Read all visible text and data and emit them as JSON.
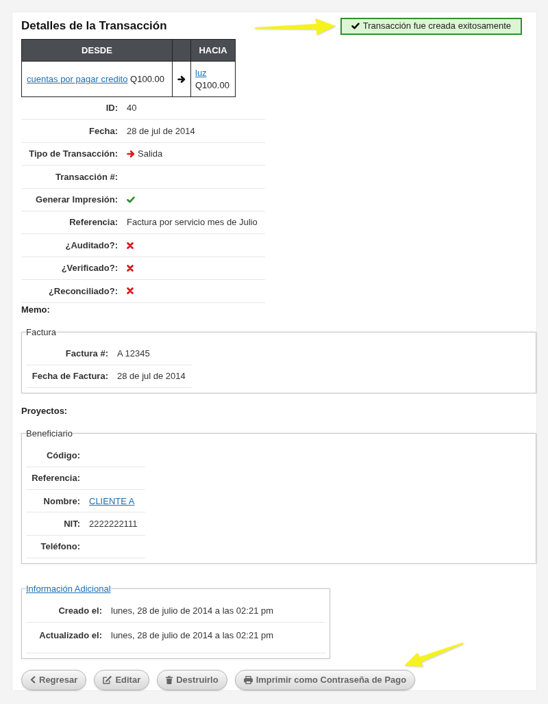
{
  "page": {
    "title": "Detalles de la Transacción"
  },
  "alert": {
    "kind": "success",
    "text": "Transacción fue creada exitosamente"
  },
  "transfer": {
    "columns": [
      "DESDE",
      "HACIA"
    ],
    "from": {
      "account": "cuentas por pagar credito",
      "amount": "Q100.00"
    },
    "to": {
      "account": "luz",
      "amount": "Q100.00"
    }
  },
  "details": [
    {
      "label": "ID:",
      "kind": "text",
      "value": "40"
    },
    {
      "label": "Fecha:",
      "kind": "text",
      "value": "28 de jul de 2014"
    },
    {
      "label": "Tipo de Transacción:",
      "kind": "direction",
      "value": "Salida"
    },
    {
      "label": "Transacción #:",
      "kind": "text"
    },
    {
      "label": "Generar Impresión:",
      "kind": "flag",
      "checked": true
    },
    {
      "label": "Referencia:",
      "kind": "text",
      "value": "Factura por servicio mes de Julio"
    },
    {
      "label": "¿Auditado?:",
      "kind": "flag",
      "checked": false
    },
    {
      "label": "¿Verificado?:",
      "kind": "flag",
      "checked": false
    },
    {
      "label": "¿Reconciliado?:",
      "kind": "flag",
      "checked": false
    }
  ],
  "memo": {
    "label": "Memo:"
  },
  "invoice": {
    "legend": "Factura",
    "legend_link": false,
    "rows": [
      {
        "label": "Factura #:",
        "kind": "text",
        "value": "A 12345"
      },
      {
        "label": "Fecha de Factura:",
        "kind": "text",
        "value": "28 de jul de 2014"
      }
    ]
  },
  "projects": {
    "label": "Proyectos:"
  },
  "beneficiary": {
    "legend": "Beneficiario",
    "legend_link": false,
    "rows": [
      {
        "label": "Código:",
        "kind": "text"
      },
      {
        "label": "Referencia:",
        "kind": "text"
      },
      {
        "label": "Nombre:",
        "kind": "link",
        "value": "CLIENTE A"
      },
      {
        "label": "NIT:",
        "kind": "text",
        "value": "2222222111"
      },
      {
        "label": "Teléfono:",
        "kind": "text"
      }
    ]
  },
  "additional_info": {
    "legend": "Información Adicional",
    "legend_link": true,
    "rows": [
      {
        "label": "Creado el:",
        "kind": "text",
        "value": "lunes, 28 de julio de 2014 a las 02:21 pm"
      },
      {
        "label": "Actualizado el:",
        "kind": "text",
        "value": "lunes, 28 de julio de 2014 a las 02:21 pm"
      }
    ]
  },
  "buttons": [
    {
      "label": "Regresar",
      "kind": "back"
    },
    {
      "label": "Editar",
      "kind": "edit"
    },
    {
      "label": "Destruirlo",
      "kind": "delete"
    },
    {
      "label": "Imprimir como Contraseña de Pago",
      "kind": "print"
    }
  ]
}
